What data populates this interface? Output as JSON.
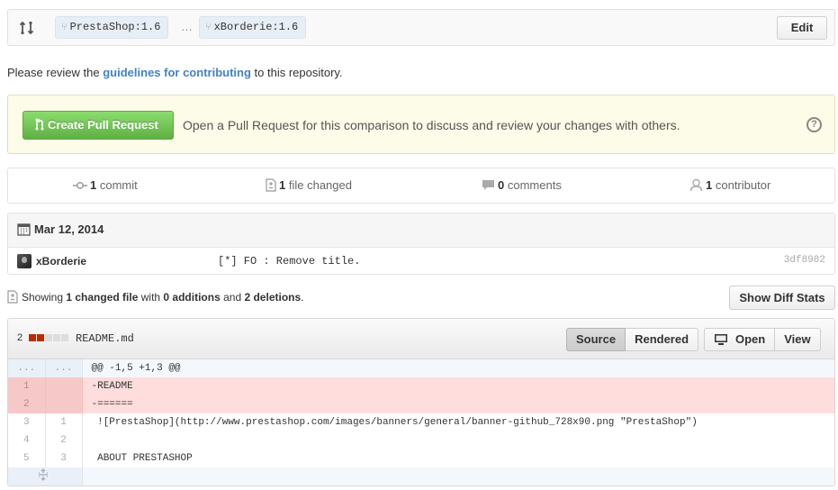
{
  "range": {
    "base": "PrestaShop:1.6",
    "ellipsis": "…",
    "head": "xBorderie:1.6",
    "edit_label": "Edit"
  },
  "notice": {
    "prefix": "Please review the ",
    "link": "guidelines for contributing",
    "suffix": " to this repository."
  },
  "pull_request": {
    "button_label": "Create Pull Request",
    "description": "Open a Pull Request for this comparison to discuss and review your changes with others.",
    "help_glyph": "?"
  },
  "summary": {
    "commits_count": "1",
    "commits_label": "commit",
    "files_count": "1",
    "files_label": "file changed",
    "comments_count": "0",
    "comments_label": "comments",
    "contributors_count": "1",
    "contributors_label": "contributor"
  },
  "commit_group": {
    "date": "Mar 12, 2014",
    "author": "xBorderie",
    "message": "[*] FO : Remove title.",
    "sha": "3df8982"
  },
  "toc": {
    "showing": "Showing ",
    "changed_files": "1 changed file",
    "with": " with ",
    "additions": "0 additions",
    "and": " and ",
    "deletions": "2 deletions",
    "period": ".",
    "diff_stats_label": "Show Diff Stats"
  },
  "file": {
    "change_count": "2",
    "name": "README.md",
    "stat_blocks": [
      "del",
      "del",
      "neu",
      "neu",
      "neu"
    ],
    "view_source": "Source",
    "view_rendered": "Rendered",
    "open_label": "Open",
    "view_label": "View"
  },
  "diff": {
    "hunk_left": "...",
    "hunk_right": "...",
    "hunk_header": "@@ -1,5 +1,3 @@",
    "lines": [
      {
        "type": "del",
        "old": "1",
        "new": "",
        "code": "-README"
      },
      {
        "type": "del",
        "old": "2",
        "new": "",
        "code": "-======"
      },
      {
        "type": "ctx",
        "old": "3",
        "new": "1",
        "code": " ![PrestaShop](http://www.prestashop.com/images/banners/general/banner-github_728x90.png \"PrestaShop\")"
      },
      {
        "type": "ctx",
        "old": "4",
        "new": "2",
        "code": ""
      },
      {
        "type": "ctx",
        "old": "5",
        "new": "3",
        "code": " ABOUT PRESTASHOP"
      }
    ]
  },
  "colors": {
    "link": "#4183c4",
    "pr_button": "#60b044",
    "deletion_bg": "#ffdddd",
    "deletion_block": "#bd2c00"
  }
}
